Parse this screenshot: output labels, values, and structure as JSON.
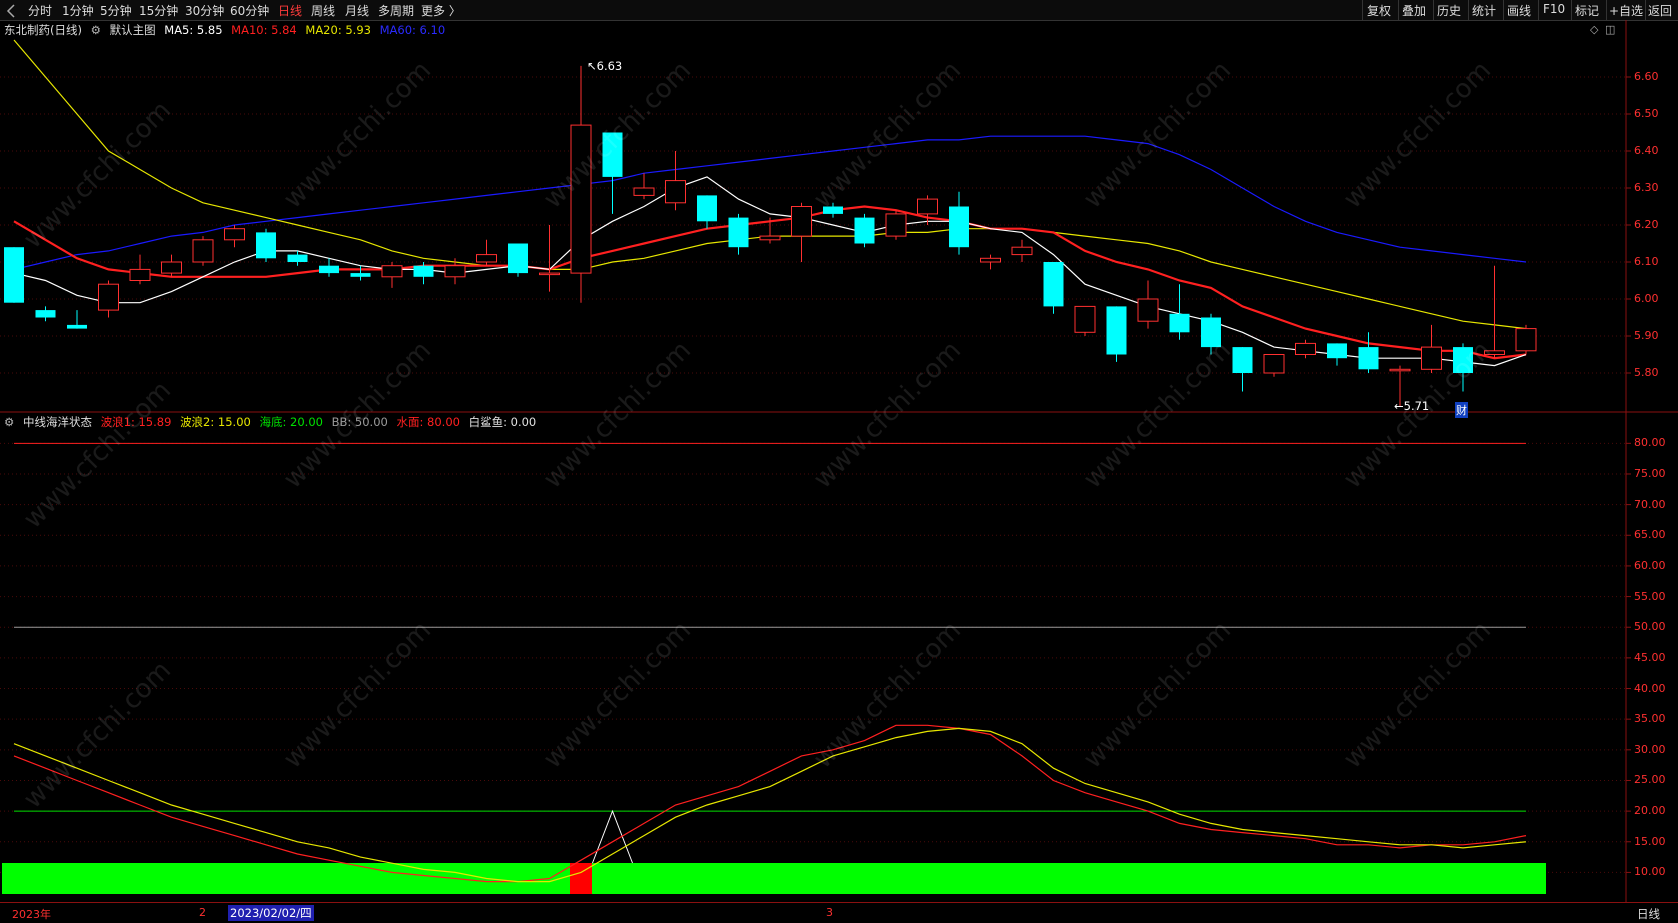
{
  "toolbar": {
    "periods": [
      "分时",
      "1分钟",
      "5分钟",
      "15分钟",
      "30分钟",
      "60分钟",
      "日线",
      "周线",
      "月线",
      "多周期",
      "更多 〉"
    ],
    "active_period": "日线",
    "right_buttons": [
      "复权",
      "叠加",
      "历史",
      "统计",
      "画线",
      "F10",
      "标记",
      "+自选",
      "返回"
    ]
  },
  "main_panel": {
    "stock_name": "东北制药(日线)",
    "chart_name": "默认主图",
    "ma": [
      {
        "label": "MA5: 5.85",
        "color": "#ffffff"
      },
      {
        "label": "MA10: 5.84",
        "color": "#ff2020"
      },
      {
        "label": "MA20: 5.93",
        "color": "#e6e600"
      },
      {
        "label": "MA60: 6.10",
        "color": "#2a2aff"
      }
    ],
    "high_label": "6.63",
    "low_label": "5.71",
    "cai_badge": "财",
    "price_ticks": [
      "6.60",
      "6.50",
      "6.40",
      "6.30",
      "6.20",
      "6.10",
      "6.00",
      "5.90",
      "5.80"
    ]
  },
  "sub_panel": {
    "indicator_name": "中线海洋状态",
    "legend": [
      {
        "label": "波浪1: 15.89",
        "color": "#ff2020"
      },
      {
        "label": "波浪2: 15.00",
        "color": "#e6e600"
      },
      {
        "label": "海底: 20.00",
        "color": "#00e000"
      },
      {
        "label": "BB: 50.00",
        "color": "#9a9a9a"
      },
      {
        "label": "水面: 80.00",
        "color": "#ff2020"
      },
      {
        "label": "白鲨鱼: 0.00",
        "color": "#e0e0e0"
      }
    ],
    "value_ticks": [
      "80.00",
      "75.00",
      "70.00",
      "65.00",
      "60.00",
      "55.00",
      "50.00",
      "45.00",
      "40.00",
      "35.00",
      "30.00",
      "25.00",
      "20.00",
      "15.00",
      "10.00"
    ]
  },
  "bottom": {
    "year_label": "2023年",
    "month_2": "2",
    "cursor_date": "2023/02/02/四",
    "month_3": "3",
    "period_label": "日线"
  },
  "watermark_text": "www.cfchi.com",
  "colors": {
    "up": "#ff3030",
    "down": "#00ffff",
    "ma5": "#ffffff",
    "ma10": "#ff2020",
    "ma20": "#e6e600",
    "ma60": "#1a1aff",
    "wave1": "#ff2020",
    "wave2": "#e6e600",
    "seabed": "#00e000",
    "bb": "#9a9a9a",
    "surface": "#ff2020",
    "bar_green": "#00ff00",
    "bar_red": "#ff0000"
  },
  "chart_data": {
    "type": "candlestick",
    "price_range": [
      5.7,
      6.7
    ],
    "candles": [
      {
        "o": 6.14,
        "c": 5.99,
        "h": 6.14,
        "l": 5.99
      },
      {
        "o": 5.97,
        "c": 5.95,
        "h": 5.98,
        "l": 5.94
      },
      {
        "o": 5.93,
        "c": 5.92,
        "h": 5.97,
        "l": 5.92
      },
      {
        "o": 5.97,
        "c": 6.04,
        "h": 6.05,
        "l": 5.95
      },
      {
        "o": 6.05,
        "c": 6.08,
        "h": 6.12,
        "l": 6.04
      },
      {
        "o": 6.07,
        "c": 6.1,
        "h": 6.12,
        "l": 6.06
      },
      {
        "o": 6.1,
        "c": 6.16,
        "h": 6.17,
        "l": 6.09
      },
      {
        "o": 6.16,
        "c": 6.19,
        "h": 6.2,
        "l": 6.14
      },
      {
        "o": 6.18,
        "c": 6.11,
        "h": 6.19,
        "l": 6.1
      },
      {
        "o": 6.12,
        "c": 6.1,
        "h": 6.13,
        "l": 6.09
      },
      {
        "o": 6.09,
        "c": 6.07,
        "h": 6.11,
        "l": 6.06
      },
      {
        "o": 6.07,
        "c": 6.06,
        "h": 6.09,
        "l": 6.05
      },
      {
        "o": 6.06,
        "c": 6.09,
        "h": 6.1,
        "l": 6.03
      },
      {
        "o": 6.09,
        "c": 6.06,
        "h": 6.1,
        "l": 6.04
      },
      {
        "o": 6.06,
        "c": 6.09,
        "h": 6.11,
        "l": 6.04
      },
      {
        "o": 6.1,
        "c": 6.12,
        "h": 6.16,
        "l": 6.09
      },
      {
        "o": 6.15,
        "c": 6.07,
        "h": 6.15,
        "l": 6.06
      },
      {
        "o": 6.07,
        "c": 6.07,
        "h": 6.2,
        "l": 6.02
      },
      {
        "o": 6.07,
        "c": 6.47,
        "h": 6.63,
        "l": 5.99
      },
      {
        "o": 6.45,
        "c": 6.33,
        "h": 6.45,
        "l": 6.23
      },
      {
        "o": 6.28,
        "c": 6.3,
        "h": 6.34,
        "l": 6.27
      },
      {
        "o": 6.26,
        "c": 6.32,
        "h": 6.4,
        "l": 6.24
      },
      {
        "o": 6.28,
        "c": 6.21,
        "h": 6.28,
        "l": 6.19
      },
      {
        "o": 6.22,
        "c": 6.14,
        "h": 6.23,
        "l": 6.12
      },
      {
        "o": 6.16,
        "c": 6.17,
        "h": 6.22,
        "l": 6.15
      },
      {
        "o": 6.17,
        "c": 6.25,
        "h": 6.26,
        "l": 6.1
      },
      {
        "o": 6.25,
        "c": 6.23,
        "h": 6.26,
        "l": 6.22
      },
      {
        "o": 6.22,
        "c": 6.15,
        "h": 6.23,
        "l": 6.14
      },
      {
        "o": 6.17,
        "c": 6.23,
        "h": 6.24,
        "l": 6.16
      },
      {
        "o": 6.23,
        "c": 6.27,
        "h": 6.28,
        "l": 6.2
      },
      {
        "o": 6.25,
        "c": 6.14,
        "h": 6.29,
        "l": 6.12
      },
      {
        "o": 6.1,
        "c": 6.11,
        "h": 6.12,
        "l": 6.08
      },
      {
        "o": 6.12,
        "c": 6.14,
        "h": 6.16,
        "l": 6.1
      },
      {
        "o": 6.1,
        "c": 5.98,
        "h": 6.1,
        "l": 5.96
      },
      {
        "o": 5.91,
        "c": 5.98,
        "h": 5.98,
        "l": 5.9
      },
      {
        "o": 5.98,
        "c": 5.85,
        "h": 5.98,
        "l": 5.83
      },
      {
        "o": 5.94,
        "c": 6.0,
        "h": 6.05,
        "l": 5.92
      },
      {
        "o": 5.96,
        "c": 5.91,
        "h": 6.04,
        "l": 5.89
      },
      {
        "o": 5.95,
        "c": 5.87,
        "h": 5.96,
        "l": 5.85
      },
      {
        "o": 5.87,
        "c": 5.8,
        "h": 5.87,
        "l": 5.75
      },
      {
        "o": 5.8,
        "c": 5.85,
        "h": 5.85,
        "l": 5.79
      },
      {
        "o": 5.85,
        "c": 5.88,
        "h": 5.89,
        "l": 5.84
      },
      {
        "o": 5.88,
        "c": 5.84,
        "h": 5.88,
        "l": 5.82
      },
      {
        "o": 5.87,
        "c": 5.81,
        "h": 5.91,
        "l": 5.8
      },
      {
        "o": 5.81,
        "c": 5.81,
        "h": 5.82,
        "l": 5.71
      },
      {
        "o": 5.81,
        "c": 5.87,
        "h": 5.93,
        "l": 5.8
      },
      {
        "o": 5.87,
        "c": 5.8,
        "h": 5.88,
        "l": 5.75
      },
      {
        "o": 5.85,
        "c": 5.86,
        "h": 6.09,
        "l": 5.84
      },
      {
        "o": 5.86,
        "c": 5.92,
        "h": 5.93,
        "l": 5.85
      }
    ],
    "ma5": [
      6.07,
      6.05,
      6.01,
      5.99,
      5.99,
      6.02,
      6.06,
      6.1,
      6.13,
      6.13,
      6.11,
      6.09,
      6.08,
      6.08,
      6.07,
      6.08,
      6.09,
      6.08,
      6.16,
      6.21,
      6.25,
      6.3,
      6.33,
      6.27,
      6.23,
      6.22,
      6.2,
      6.18,
      6.2,
      6.21,
      6.21,
      6.19,
      6.18,
      6.12,
      6.04,
      6.01,
      5.98,
      5.96,
      5.94,
      5.91,
      5.87,
      5.86,
      5.85,
      5.84,
      5.84,
      5.84,
      5.83,
      5.82,
      5.85
    ],
    "ma10": [
      6.21,
      6.16,
      6.11,
      6.08,
      6.07,
      6.06,
      6.06,
      6.06,
      6.06,
      6.07,
      6.08,
      6.08,
      6.08,
      6.09,
      6.09,
      6.09,
      6.09,
      6.08,
      6.11,
      6.13,
      6.15,
      6.17,
      6.19,
      6.2,
      6.21,
      6.22,
      6.24,
      6.25,
      6.24,
      6.22,
      6.21,
      6.19,
      6.19,
      6.18,
      6.13,
      6.1,
      6.08,
      6.05,
      6.03,
      5.98,
      5.95,
      5.92,
      5.9,
      5.88,
      5.87,
      5.86,
      5.86,
      5.84,
      5.85
    ],
    "ma20": [
      6.7,
      6.6,
      6.5,
      6.4,
      6.35,
      6.3,
      6.26,
      6.24,
      6.22,
      6.2,
      6.18,
      6.16,
      6.13,
      6.11,
      6.1,
      6.09,
      6.09,
      6.08,
      6.08,
      6.1,
      6.11,
      6.13,
      6.15,
      6.16,
      6.17,
      6.17,
      6.17,
      6.17,
      6.18,
      6.18,
      6.19,
      6.19,
      6.19,
      6.18,
      6.17,
      6.16,
      6.15,
      6.13,
      6.1,
      6.08,
      6.06,
      6.04,
      6.02,
      6.0,
      5.98,
      5.96,
      5.94,
      5.93,
      5.92
    ],
    "ma60": [
      6.08,
      6.1,
      6.12,
      6.13,
      6.15,
      6.17,
      6.18,
      6.2,
      6.21,
      6.22,
      6.23,
      6.24,
      6.25,
      6.26,
      6.27,
      6.28,
      6.29,
      6.3,
      6.31,
      6.32,
      6.34,
      6.35,
      6.36,
      6.37,
      6.38,
      6.39,
      6.4,
      6.41,
      6.42,
      6.43,
      6.43,
      6.44,
      6.44,
      6.44,
      6.44,
      6.43,
      6.42,
      6.39,
      6.35,
      6.3,
      6.25,
      6.21,
      6.18,
      6.16,
      6.14,
      6.13,
      6.12,
      6.11,
      6.1
    ],
    "indicator_range": [
      5,
      82
    ],
    "wave1": [
      29,
      27,
      25,
      23,
      21,
      19,
      17.5,
      16,
      14.5,
      13,
      12,
      11,
      10,
      9.5,
      9,
      8.5,
      8.5,
      9,
      12,
      15,
      18,
      21,
      22.5,
      24,
      26.5,
      29,
      30,
      31.5,
      34,
      34,
      33.5,
      32.5,
      29,
      25,
      23,
      21.5,
      20,
      18,
      17,
      16.5,
      16,
      15.5,
      14.5,
      14.5,
      14,
      14.5,
      14.5,
      15,
      16
    ],
    "wave2": [
      31,
      29,
      27,
      25,
      23,
      21,
      19.5,
      18,
      16.5,
      15,
      14,
      12.5,
      11.5,
      10.5,
      10,
      9,
      8.5,
      8.5,
      10,
      13,
      16,
      19,
      21,
      22.5,
      24,
      26.5,
      29,
      30.5,
      32,
      33,
      33.5,
      33,
      31,
      27,
      24.5,
      23,
      21.5,
      19.5,
      18,
      17,
      16.5,
      16,
      15.5,
      15,
      14.5,
      14.5,
      14,
      14.5,
      15
    ],
    "seabed": 20,
    "bb": 50,
    "surface": 80,
    "whiteshark_spike": {
      "index": 18,
      "peak": 20
    },
    "state_bar_red_index": 18
  }
}
